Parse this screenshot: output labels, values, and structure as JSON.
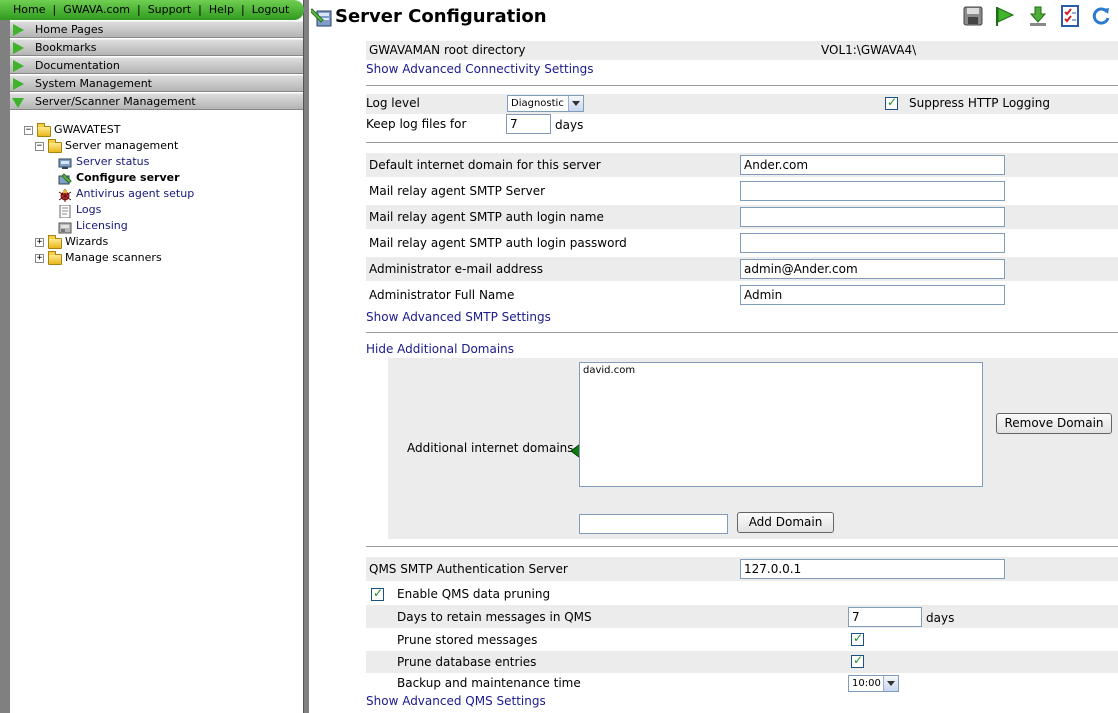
{
  "top_nav": [
    "Home",
    "GWAVA.com",
    "Support",
    "Help",
    "Logout"
  ],
  "menu_bars": [
    "Home Pages",
    "Bookmarks",
    "Documentation",
    "System Management",
    "Server/Scanner Management"
  ],
  "tree": {
    "root": "GWAVATEST",
    "server_management": "Server management",
    "children": [
      "Server status",
      "Configure server",
      "Antivirus agent setup",
      "Logs",
      "Licensing"
    ],
    "wizards": "Wizards",
    "manage_scanners": "Manage scanners"
  },
  "page": {
    "title": "Server Configuration",
    "toolbar_icons": [
      "save-icon",
      "bookmark-flag-icon",
      "download-icon",
      "checklist-icon",
      "refresh-icon"
    ]
  },
  "connectivity": {
    "root_dir_label": "GWAVAMAN root directory",
    "root_dir_value": "VOL1:\\GWAVA4\\",
    "advanced_link": "Show Advanced Connectivity Settings"
  },
  "logging": {
    "log_level_label": "Log level",
    "log_level_value": "Diagnostic",
    "suppress_label": "Suppress HTTP Logging",
    "suppress_checked": true,
    "keep_label": "Keep log files for",
    "keep_value": "7",
    "keep_unit": "days"
  },
  "smtp": {
    "fields": [
      {
        "label": "Default internet domain for this server",
        "value": "Ander.com"
      },
      {
        "label": "Mail relay agent SMTP Server",
        "value": ""
      },
      {
        "label": "Mail relay agent SMTP auth login name",
        "value": ""
      },
      {
        "label": "Mail relay agent SMTP auth login password",
        "value": ""
      },
      {
        "label": "Administrator e-mail address",
        "value": "admin@Ander.com"
      },
      {
        "label": "Administrator Full Name",
        "value": "Admin"
      }
    ],
    "advanced_link": "Show Advanced SMTP Settings"
  },
  "domains": {
    "hide_link": "Hide Additional Domains",
    "label": "Additional internet domains",
    "list": [
      "david.com"
    ],
    "remove_button": "Remove Domain",
    "add_input": "",
    "add_button": "Add Domain"
  },
  "qms": {
    "auth_label": "QMS SMTP Authentication Server",
    "auth_value": "127.0.0.1",
    "pruning_label": "Enable QMS data pruning",
    "pruning_checked": true,
    "retain_label": "Days to retain messages in QMS",
    "retain_value": "7",
    "retain_unit": "days",
    "prune_stored_label": "Prune stored messages",
    "prune_stored_checked": true,
    "prune_db_label": "Prune database entries",
    "prune_db_checked": true,
    "backup_label": "Backup and maintenance time",
    "backup_value": "10:00",
    "advanced_link": "Show Advanced QMS Settings"
  },
  "colors": {
    "nav_green": "#3fb42a",
    "link_blue": "#1a1a8e",
    "row_shade": "#ececec"
  }
}
